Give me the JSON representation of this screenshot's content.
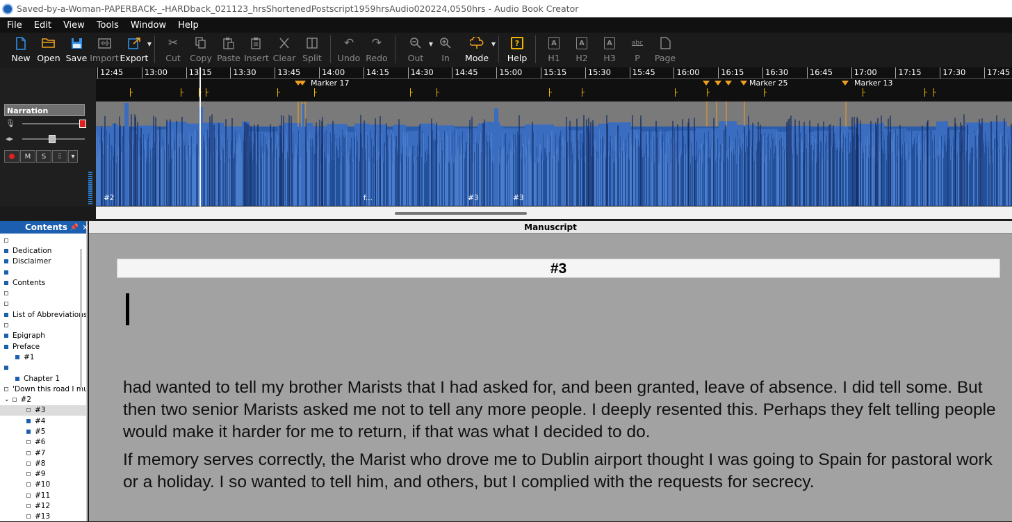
{
  "window": {
    "title": "Saved-by-a-Woman-PAPERBACK-_-HARDback_021123_hrsShortenedPostscript1959hrsAudio020224,0550hrs - Audio Book Creator"
  },
  "menu": [
    "File",
    "Edit",
    "View",
    "Tools",
    "Window",
    "Help"
  ],
  "toolbar": {
    "new": "New",
    "open": "Open",
    "save": "Save",
    "import": "Import",
    "export": "Export",
    "cut": "Cut",
    "copy": "Copy",
    "paste": "Paste",
    "insert": "Insert",
    "clear": "Clear",
    "split": "Split",
    "undo": "Undo",
    "redo": "Redo",
    "out": "Out",
    "in": "In",
    "mode": "Mode",
    "help": "Help",
    "h1": "H1",
    "h2": "H2",
    "h3": "H3",
    "p": "P",
    "page": "Page",
    "h1_glyph": "A",
    "h2_glyph": "A",
    "h3_glyph": "A",
    "p_glyph": "abc",
    "help_glyph": "?",
    "accent_color": "#2f8fe8",
    "export_color": "#f0a020",
    "help_color": "#f0b400"
  },
  "timeline": {
    "ruler": [
      "12:45",
      "13:00",
      "13:15",
      "13:30",
      "13:45",
      "14:00",
      "14:15",
      "14:30",
      "14:45",
      "15:00",
      "15:15",
      "15:30",
      "15:45",
      "16:00",
      "16:15",
      "16:30",
      "16:45",
      "17:00",
      "17:15",
      "17:30",
      "17:45"
    ],
    "markers": [
      "Marker 17",
      "Marker 25",
      "Marker 13"
    ],
    "track_name": "Narration",
    "segment_labels": [
      "#2",
      "f...",
      "#3",
      "#3"
    ],
    "buttons": {
      "mute": "M",
      "solo": "S"
    },
    "waveform_color": "#2a5cab",
    "marker_color": "#f0a020"
  },
  "contents": {
    "title": "Contents",
    "items": [
      {
        "label": "",
        "filled": false
      },
      {
        "label": "Dedication",
        "filled": true
      },
      {
        "label": "Disclaimer",
        "filled": true
      },
      {
        "label": "",
        "filled": true
      },
      {
        "label": "Contents",
        "filled": true
      },
      {
        "label": "",
        "filled": false
      },
      {
        "label": "",
        "filled": false
      },
      {
        "label": "List of Abbreviations",
        "filled": true
      },
      {
        "label": "",
        "filled": false
      },
      {
        "label": "Epigraph",
        "filled": true
      },
      {
        "label": "Preface",
        "filled": true
      },
      {
        "label": "#1",
        "filled": true
      },
      {
        "label": "",
        "filled": true
      },
      {
        "label": "Chapter 1",
        "filled": true
      },
      {
        "label": "'Down this road I mu",
        "filled": false
      },
      {
        "label": "#2",
        "filled": false
      },
      {
        "label": "#3",
        "filled": false
      },
      {
        "label": "#4",
        "filled": true
      },
      {
        "label": "#5",
        "filled": true
      },
      {
        "label": "#6",
        "filled": false
      },
      {
        "label": "#7",
        "filled": false
      },
      {
        "label": "#8",
        "filled": false
      },
      {
        "label": "#9",
        "filled": false
      },
      {
        "label": "#10",
        "filled": false
      },
      {
        "label": "#11",
        "filled": false
      },
      {
        "label": "#12",
        "filled": false
      },
      {
        "label": "#13",
        "filled": false
      }
    ]
  },
  "manuscript": {
    "title": "Manuscript",
    "heading": "#3",
    "paragraphs": [
      "had wanted to tell my brother Marists that I had asked for, and been granted, leave of absence. I did tell some. But then two senior Marists asked me not to tell any more people. I deeply resented this. Perhaps they felt telling people would make it harder for me to return, if that was what I decided to do.",
      "If memory serves correctly, the Marist who drove me to Dublin airport thought I was going to Spain for pastoral work or a holiday. I so wanted to tell him, and others, but I complied with the requests for secrecy."
    ]
  }
}
